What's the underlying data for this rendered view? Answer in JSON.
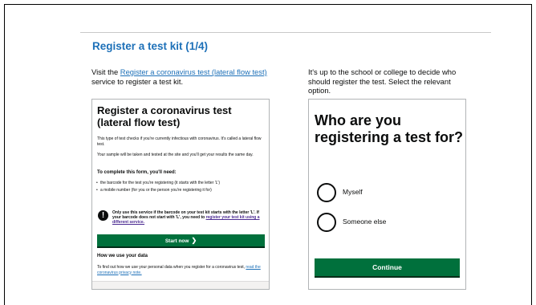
{
  "slide": {
    "title": "Register a test kit (1/4)",
    "left_intro": {
      "prefix": "Visit the ",
      "link": "Register a coronavirus test (lateral flow test)",
      "suffix": " service to register a test kit."
    },
    "right_intro": "It's up to the school or college to decide who should register the test. Select the relevant option."
  },
  "service_page": {
    "heading": "Register a coronavirus test (lateral flow test)",
    "para1": "This type of test checks if you're currently infectious with coronavirus. It's called a lateral flow test.",
    "para2": "Your sample will be taken and tested at the site and you'll get your results the same day.",
    "complete_heading": "To complete this form, you'll need:",
    "bullets": [
      "the barcode for the test you're registering (it starts with the letter 'L')",
      "a mobile number (for you or the person you're registering it for)"
    ],
    "warning_text": "Only use this service if the barcode on your test kit starts with the letter 'L'. If your barcode does not start with 'L', you need to ",
    "warning_link": "register your test kit using a different service.",
    "start_button": "Start now",
    "data_heading": "How we use your data",
    "data_text": "To find out how we use your personal data when you register for a coronavirus test, ",
    "data_link": "read the coronavirus privacy note."
  },
  "question_page": {
    "heading": "Who are you registering a test for?",
    "options": [
      "Myself",
      "Someone else"
    ],
    "continue_button": "Continue"
  },
  "colors": {
    "link": "#1d70b8",
    "button_green": "#00703c",
    "text": "#0b0c0c"
  }
}
